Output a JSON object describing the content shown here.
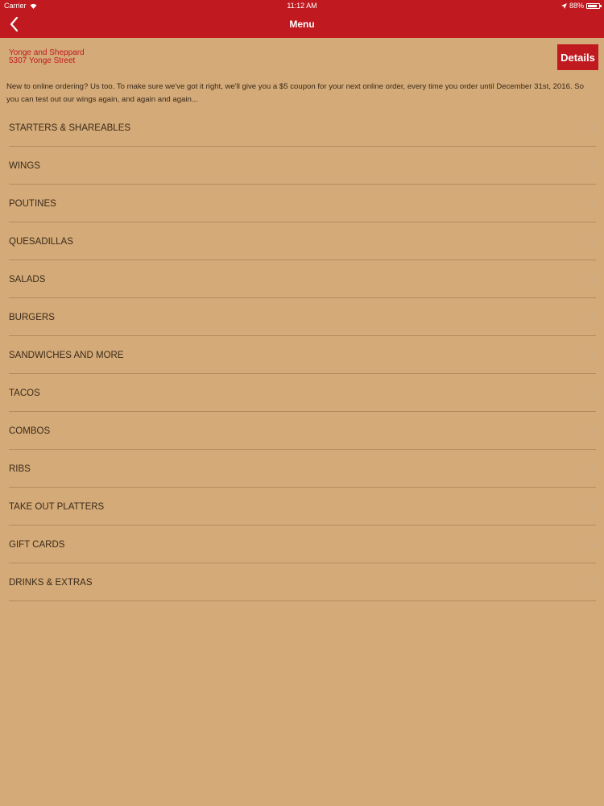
{
  "status_bar": {
    "carrier": "Carrier",
    "time": "11:12 AM",
    "battery": "88%",
    "battery_level": 0.88
  },
  "nav": {
    "title": "Menu",
    "back_icon": "chevron-left-icon"
  },
  "store": {
    "name": "Yonge and Sheppard",
    "address": "5307 Yonge Street"
  },
  "details_label": "Details",
  "promo_text": "New to online ordering? Us too. To make sure we've got it right, we'll give you a $5 coupon for your next online order, every time you order until December 31st, 2016. So you can test out our wings again, and again and again...",
  "menu": [
    {
      "label": "STARTERS & SHAREABLES"
    },
    {
      "label": "WINGS"
    },
    {
      "label": "POUTINES"
    },
    {
      "label": "QUESADILLAS"
    },
    {
      "label": "SALADS"
    },
    {
      "label": "BURGERS"
    },
    {
      "label": "SANDWICHES AND MORE"
    },
    {
      "label": "TACOS"
    },
    {
      "label": "COMBOS"
    },
    {
      "label": "RIBS"
    },
    {
      "label": "TAKE OUT PLATTERS"
    },
    {
      "label": "GIFT CARDS"
    },
    {
      "label": "DRINKS & EXTRAS"
    }
  ],
  "colors": {
    "brand_red": "#c0191f",
    "background": "#d4aa78",
    "divider": "#b38b5e"
  }
}
